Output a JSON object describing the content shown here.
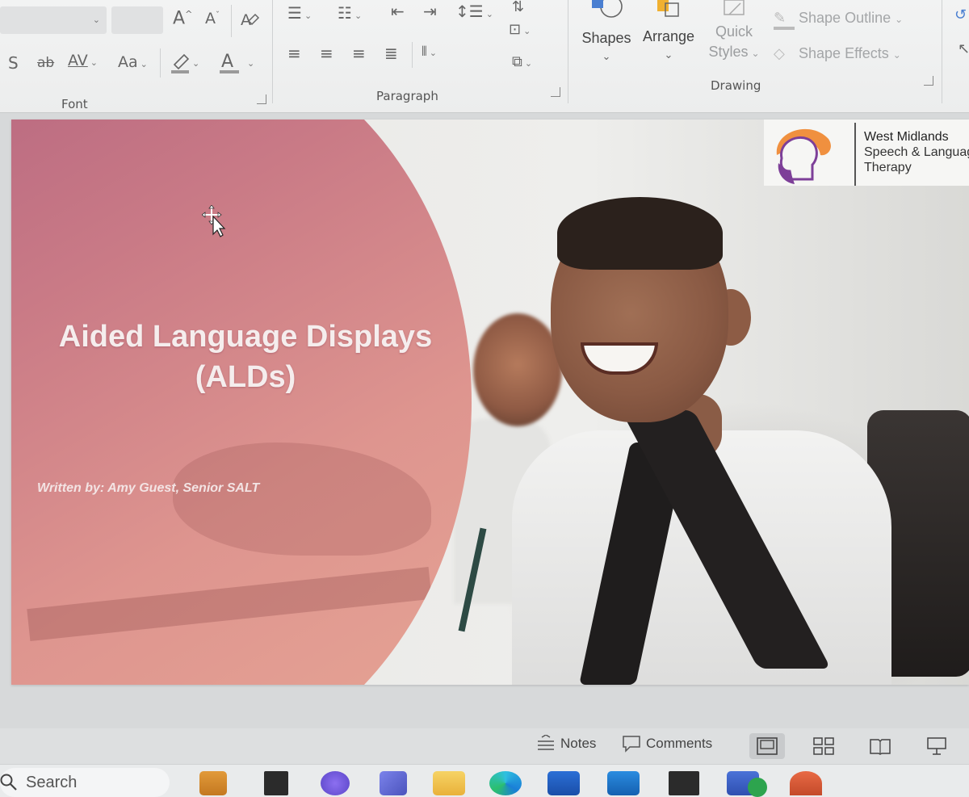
{
  "ribbon": {
    "font_group": {
      "label": "Font"
    },
    "paragraph_group": {
      "label": "Paragraph"
    },
    "drawing_group": {
      "label": "Drawing",
      "shapes_label": "Shapes",
      "arrange_label": "Arrange",
      "quick_styles_line1": "Quick",
      "quick_styles_line2": "Styles",
      "shape_outline_label": "Shape Outline",
      "shape_effects_label": "Shape Effects"
    },
    "font_buttons": {
      "grow_font": "A",
      "shrink_font": "A",
      "strikethrough": "S",
      "double_strike": "ab",
      "char_spacing": "AV",
      "change_case": "Aa",
      "font_color": "A"
    }
  },
  "slide": {
    "title_line1": "Aided Language Displays",
    "title_line2": "(ALDs)",
    "author": "Written by: Amy Guest, Senior SALT",
    "logo": {
      "line1": "West Midlands",
      "line2": "Speech & Language",
      "line3": "Therapy"
    }
  },
  "statusbar": {
    "notes_label": "Notes",
    "comments_label": "Comments"
  },
  "taskbar": {
    "search_label": "Search"
  },
  "colors": {
    "pink_panel_top": "#b0607e",
    "pink_panel_bottom": "#e7a695",
    "logo_orange": "#f0903f",
    "logo_purple": "#7d3f98"
  }
}
